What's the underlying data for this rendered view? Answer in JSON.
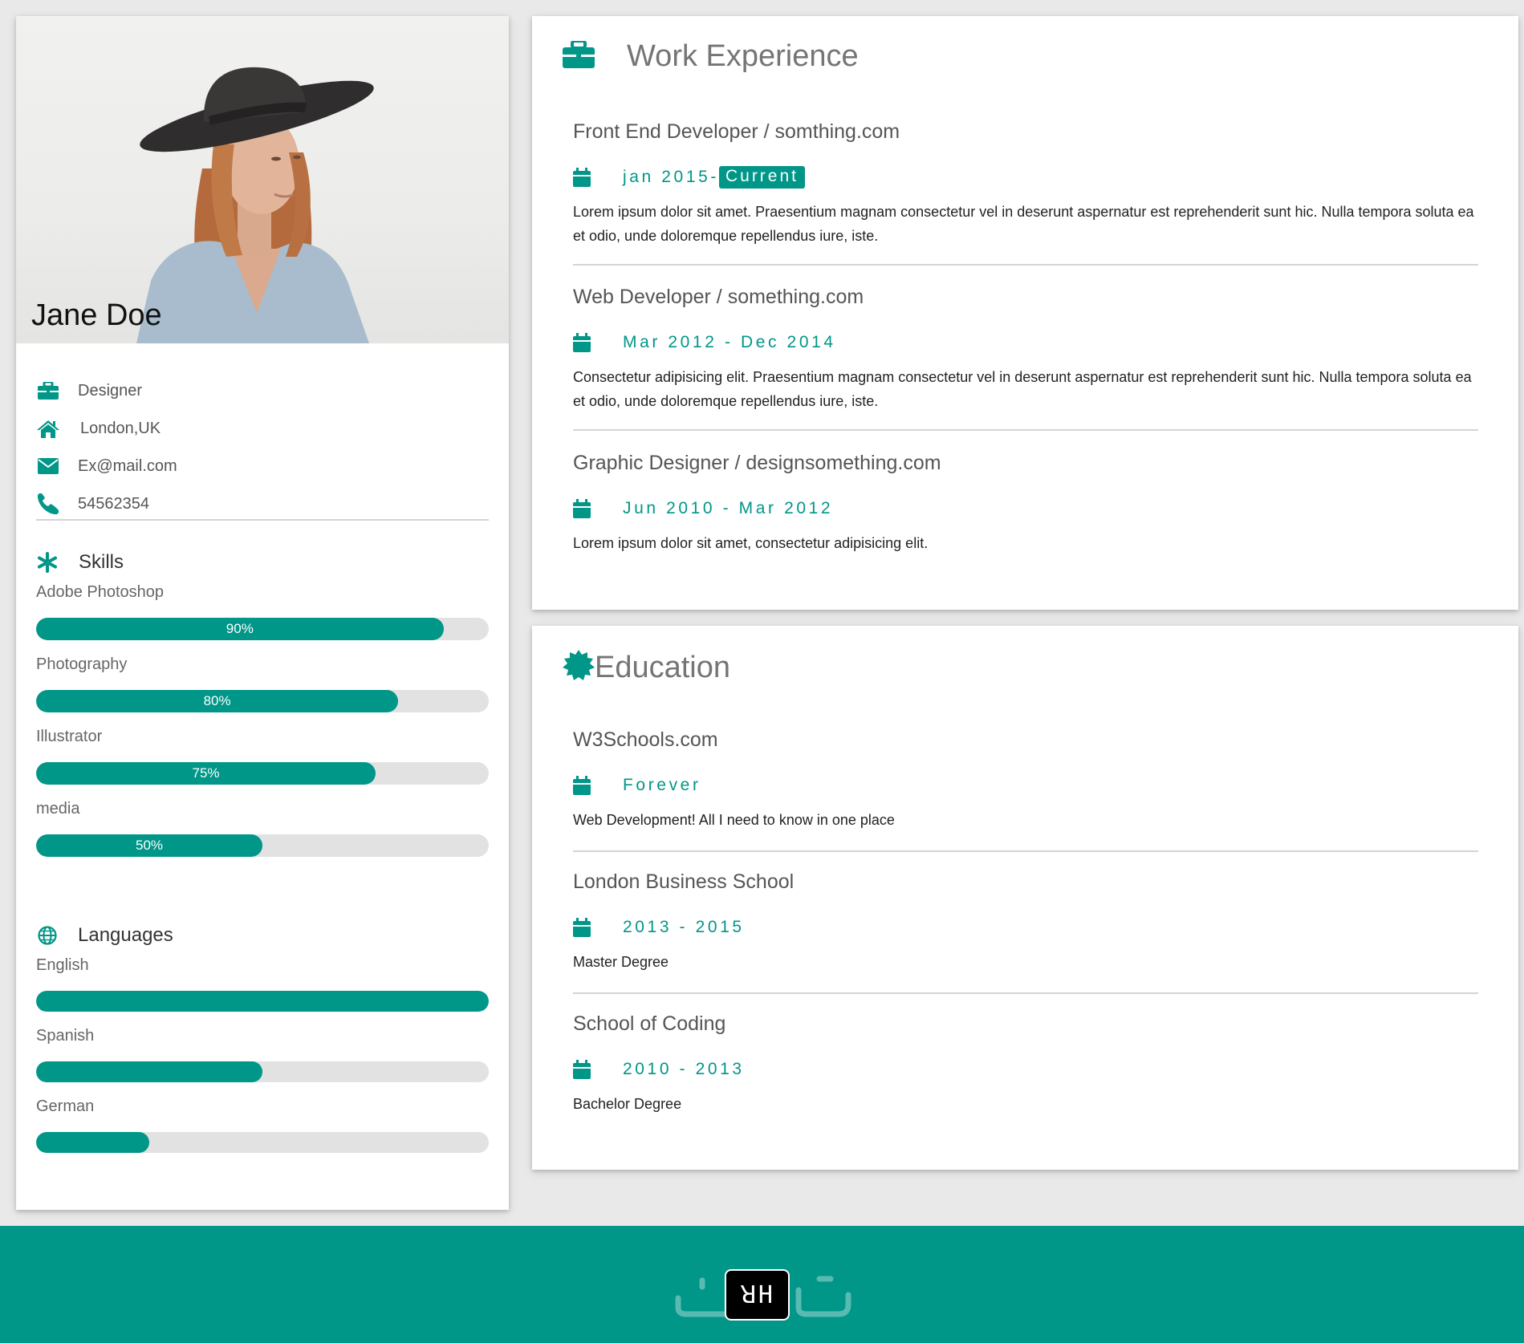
{
  "profile": {
    "name": "Jane Doe",
    "role": "Designer",
    "location": "London,UK",
    "email": "Ex@mail.com",
    "phone": "54562354"
  },
  "skills": {
    "title": "Skills",
    "items": [
      {
        "label": "Adobe Photoshop",
        "percent": 90,
        "display": "90%"
      },
      {
        "label": "Photography",
        "percent": 80,
        "display": "80%"
      },
      {
        "label": "Illustrator",
        "percent": 75,
        "display": "75%"
      },
      {
        "label": "media",
        "percent": 50,
        "display": "50%"
      }
    ]
  },
  "languages": {
    "title": "Languages",
    "items": [
      {
        "label": "English",
        "percent": 100
      },
      {
        "label": "Spanish",
        "percent": 50
      },
      {
        "label": "German",
        "percent": 25
      }
    ]
  },
  "work": {
    "title": "Work Experience",
    "items": [
      {
        "title": "Front End Developer / somthing.com",
        "date": "jan 2015-",
        "tag": "Current",
        "desc": "Lorem ipsum dolor sit amet. Praesentium magnam consectetur vel in deserunt aspernatur est reprehenderit sunt hic. Nulla tempora soluta ea et odio, unde doloremque repellendus iure, iste."
      },
      {
        "title": "Web Developer / something.com",
        "date": "Mar 2012 - Dec 2014",
        "desc": "Consectetur adipisicing elit. Praesentium magnam consectetur vel in deserunt aspernatur est reprehenderit sunt hic. Nulla tempora soluta ea et odio, unde doloremque repellendus iure, iste."
      },
      {
        "title": "Graphic Designer / designsomething.com",
        "date": "Jun 2010 - Mar 2012",
        "desc": "Lorem ipsum dolor sit amet, consectetur adipisicing elit."
      }
    ]
  },
  "education": {
    "title": "Education",
    "items": [
      {
        "title": "W3Schools.com",
        "date": "Forever",
        "desc": "Web Development! All I need to know in one place"
      },
      {
        "title": "London Business School",
        "date": "2013 - 2015",
        "desc": "Master Degree"
      },
      {
        "title": "School of Coding",
        "date": "2010 - 2013",
        "desc": "Bachelor Degree"
      }
    ]
  },
  "footer": {
    "logo_text": "ꓤH"
  },
  "colors": {
    "accent": "#009688",
    "background": "#e9e9e9",
    "card": "#ffffff"
  }
}
